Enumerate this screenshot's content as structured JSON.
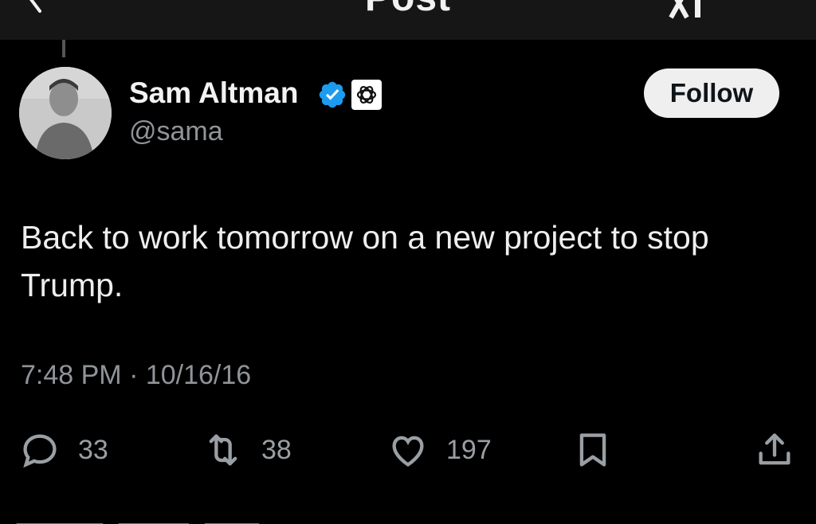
{
  "topbar": {
    "title": "Post",
    "back_icon": "arrow-left-icon",
    "grok_icon": "grok-icon"
  },
  "author": {
    "display_name": "Sam Altman",
    "handle": "@sama",
    "verified_icon": "verified-badge-icon",
    "affiliate_icon": "openai-logo-icon"
  },
  "follow_button": {
    "label": "Follow"
  },
  "tweet": {
    "text": "Back to work tomorrow on a new project to stop Trump.",
    "timestamp": "7:48 PM · 10/16/16"
  },
  "actions": {
    "replies": "33",
    "retweets": "38",
    "likes": "197"
  },
  "colors": {
    "background": "#000000",
    "topbar": "#161616",
    "verified_blue": "#1d9bf0",
    "secondary_text": "#8f9499"
  }
}
